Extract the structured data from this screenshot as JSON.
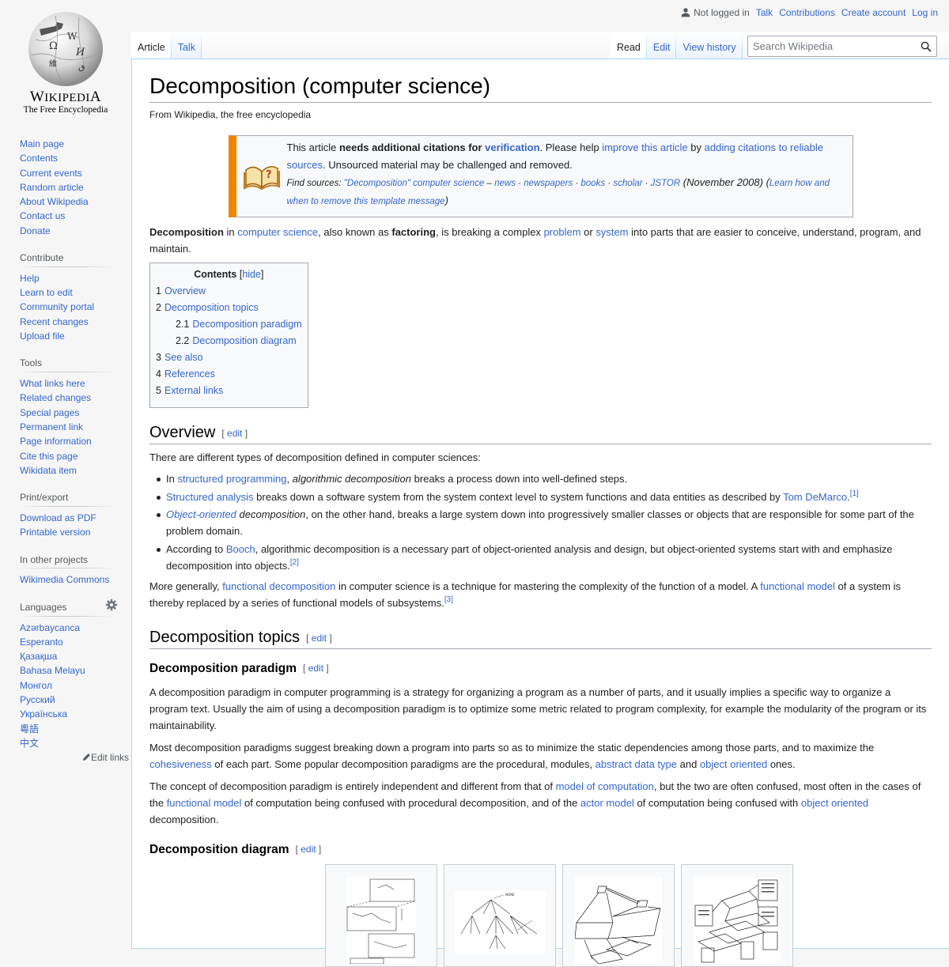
{
  "logo": {
    "wordmark": "Wikipedia",
    "tagline": "The Free Encyclopedia"
  },
  "personal": {
    "not_logged_in": "Not logged in",
    "talk": "Talk",
    "contributions": "Contributions",
    "create_account": "Create account",
    "log_in": "Log in"
  },
  "tabs": {
    "left": [
      {
        "label": "Article",
        "selected": true
      },
      {
        "label": "Talk",
        "selected": false
      }
    ],
    "right": [
      {
        "label": "Read",
        "selected": true
      },
      {
        "label": "Edit",
        "selected": false
      },
      {
        "label": "View history",
        "selected": false
      }
    ]
  },
  "search": {
    "placeholder": "Search Wikipedia",
    "value": ""
  },
  "sidebar": {
    "navigation": [
      "Main page",
      "Contents",
      "Current events",
      "Random article",
      "About Wikipedia",
      "Contact us",
      "Donate"
    ],
    "contribute": {
      "heading": "Contribute",
      "items": [
        "Help",
        "Learn to edit",
        "Community portal",
        "Recent changes",
        "Upload file"
      ]
    },
    "tools": {
      "heading": "Tools",
      "items": [
        "What links here",
        "Related changes",
        "Special pages",
        "Permanent link",
        "Page information",
        "Cite this page",
        "Wikidata item"
      ]
    },
    "print": {
      "heading": "Print/export",
      "items": [
        "Download as PDF",
        "Printable version"
      ]
    },
    "projects": {
      "heading": "In other projects",
      "items": [
        "Wikimedia Commons"
      ]
    },
    "languages": {
      "heading": "Languages",
      "items": [
        "Azərbaycanca",
        "Esperanto",
        "Қазақша",
        "Bahasa Melayu",
        "Монгол",
        "Русский",
        "Українська",
        "粵語",
        "中文"
      ],
      "edit_links": "Edit links"
    }
  },
  "article": {
    "title": "Decomposition (computer science)",
    "site_sub": "From Wikipedia, the free encyclopedia",
    "ambox": {
      "t1": "This article ",
      "t2": "needs additional citations for ",
      "t3": "verification",
      "t4": ". Please help ",
      "t5": "improve this article",
      "t6": " by ",
      "t7": "adding citations to reliable sources",
      "t8": ". Unsourced material may be challenged and removed.",
      "find_sources": "Find sources: ",
      "q": "\"Decomposition\" computer science",
      "dash": " – ",
      "news": "news",
      "newspapers": "newspapers",
      "books": "books",
      "scholar": "scholar",
      "jstor": "JSTOR",
      "sep": " · ",
      "date": " (November 2008) ",
      "learn_open": "(",
      "learn": "Learn how and when to remove this template message",
      "learn_close": ")"
    },
    "lead": {
      "b1": "Decomposition",
      "t1": " in ",
      "l1": "computer science",
      "t2": ", also known as ",
      "b2": "factoring",
      "t3": ", is breaking a complex ",
      "l2": "problem",
      "t4": " or ",
      "l3": "system",
      "t5": " into parts that are easier to conceive, understand, program, and maintain."
    },
    "toc": {
      "title": "Contents",
      "toggle_open": "[",
      "toggle": "hide",
      "toggle_close": "]",
      "items": [
        {
          "num": "1",
          "label": "Overview",
          "level": 1
        },
        {
          "num": "2",
          "label": "Decomposition topics",
          "level": 1
        },
        {
          "num": "2.1",
          "label": "Decomposition paradigm",
          "level": 2
        },
        {
          "num": "2.2",
          "label": "Decomposition diagram",
          "level": 2
        },
        {
          "num": "3",
          "label": "See also",
          "level": 1
        },
        {
          "num": "4",
          "label": "References",
          "level": 1
        },
        {
          "num": "5",
          "label": "External links",
          "level": 1
        }
      ]
    },
    "edit_open": "[ ",
    "edit": "edit",
    "edit_close": " ]",
    "overview": {
      "heading": "Overview",
      "intro": "There are different types of decomposition defined in computer sciences:",
      "b1": {
        "t1": "In ",
        "l1": "structured programming",
        "t2": ", ",
        "i1": "algorithmic decomposition",
        "t3": " breaks a process down into well-defined steps."
      },
      "b2": {
        "l1": "Structured analysis",
        "t1": " breaks down a software system from the system context level to system functions and data entities as described by ",
        "l2": "Tom DeMarco",
        "t2": ".",
        "ref": "[1]"
      },
      "b3": {
        "l1": "Object-oriented",
        "i1": " decomposition",
        "t1": ", on the other hand, breaks a large system down into progressively smaller classes or objects that are responsible for some part of the problem domain."
      },
      "b4": {
        "t1": "According to ",
        "l1": "Booch",
        "t2": ", algorithmic decomposition is a necessary part of object-oriented analysis and design, but object-oriented systems start with and emphasize decomposition into objects.",
        "ref": "[2]"
      },
      "p2": {
        "t1": "More generally, ",
        "l1": "functional decomposition",
        "t2": " in computer science is a technique for mastering the complexity of the function of a model. A ",
        "l2": "functional model",
        "t3": " of a system is thereby replaced by a series of functional models of subsystems.",
        "ref": "[3]"
      }
    },
    "topics": {
      "heading": "Decomposition topics",
      "paradigm": {
        "heading": "Decomposition paradigm",
        "p1": "A decomposition paradigm in computer programming is a strategy for organizing a program as a number of parts, and it usually implies a specific way to organize a program text. Usually the aim of using a decomposition paradigm is to optimize some metric related to program complexity, for example the modularity of the program or its maintainability.",
        "p2": {
          "t1": "Most decomposition paradigms suggest breaking down a program into parts so as to minimize the static dependencies among those parts, and to maximize the ",
          "l1": "cohesiveness",
          "t2": " of each part. Some popular decomposition paradigms are the procedural, modules, ",
          "l2": "abstract data type",
          "t3": " and ",
          "l3": "object oriented",
          "t4": " ones."
        },
        "p3": {
          "t1": "The concept of decomposition paradigm is entirely independent and different from that of ",
          "l1": "model of computation",
          "t2": ", but the two are often confused, most often in the cases of the ",
          "l2": "functional model",
          "t3": " of computation being confused with procedural decomposition, and of the ",
          "l3": "actor model",
          "t4": " of computation being confused with ",
          "l4": "object oriented",
          "t5": " decomposition."
        }
      },
      "diagram": {
        "heading": "Decomposition diagram",
        "images": [
          "decomposition-diagram-1",
          "decomposition-tree-diagram",
          "design-model-diagram",
          "requirements-model-diagram"
        ]
      }
    }
  },
  "colors": {
    "link": "#3366cc",
    "ambox_border": "#f28500",
    "text": "#202122"
  }
}
